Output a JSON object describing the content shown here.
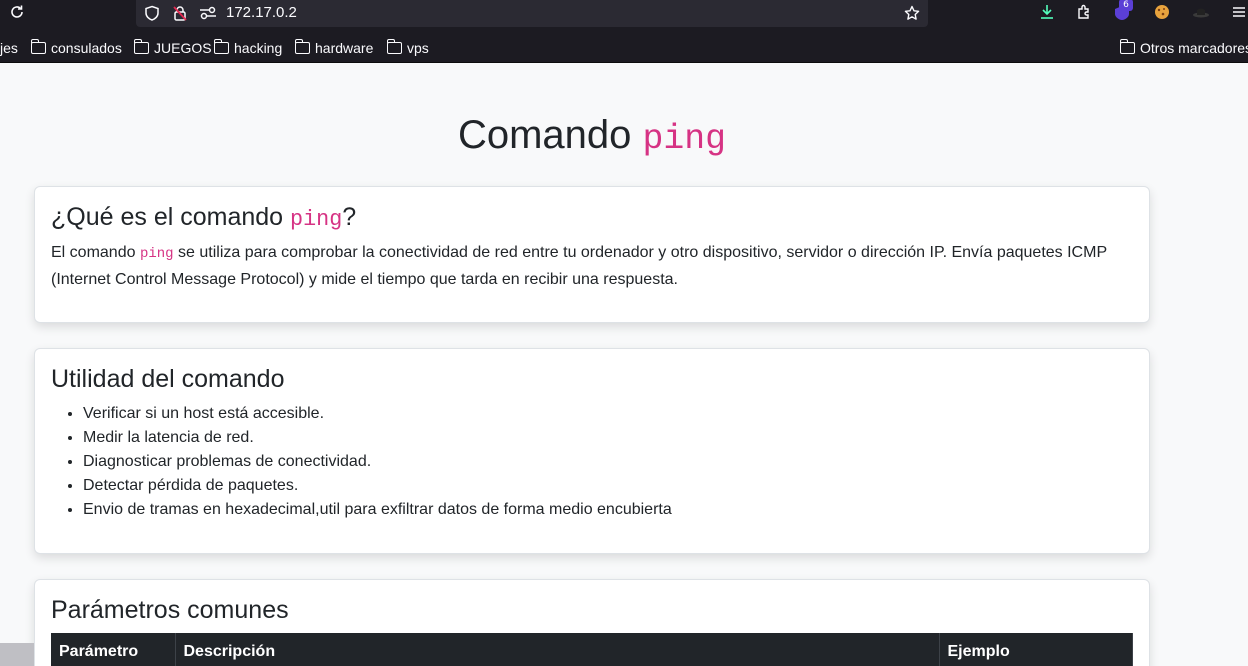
{
  "browser": {
    "url": "172.17.0.2",
    "download_badge": "6",
    "bookmarks": [
      "jes",
      "consulados",
      "JUEGOS",
      "hacking",
      "hardware",
      "vps"
    ],
    "other_bookmarks": "Otros marcadores"
  },
  "page": {
    "title_text": "Comando",
    "title_code": "ping",
    "section1": {
      "heading_text": "¿Qué es el comando",
      "heading_code": "ping",
      "heading_suffix": "?",
      "p_start": "El comando",
      "p_code": "ping",
      "p_rest": "se utiliza para comprobar la conectividad de red entre tu ordenador y otro dispositivo, servidor o dirección IP. Envía paquetes ICMP (Internet Control Message Protocol) y mide el tiempo que tarda en recibir una respuesta."
    },
    "section2": {
      "heading": "Utilidad del comando",
      "items": [
        "Verificar si un host está accesible.",
        "Medir la latencia de red.",
        "Diagnosticar problemas de conectividad.",
        "Detectar pérdida de paquetes.",
        "Envio de tramas en hexadecimal,util para exfiltrar datos de forma medio encubierta"
      ]
    },
    "section3": {
      "heading": "Parámetros comunes",
      "columns": [
        "Parámetro",
        "Descripción",
        "Ejemplo"
      ]
    }
  }
}
